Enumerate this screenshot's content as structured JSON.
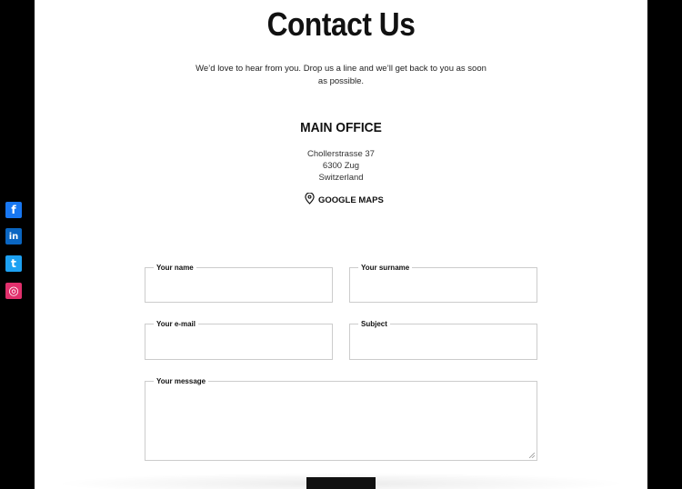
{
  "page": {
    "title": "Contact Us",
    "intro": "We’d love to hear from you. Drop us a line and we’ll get back to you as soon as possible."
  },
  "office": {
    "title": "MAIN OFFICE",
    "address_line1": "Chollerstrasse 37",
    "address_line2": "6300 Zug",
    "address_line3": "Switzerland",
    "maps_label": "GOOGLE MAPS"
  },
  "form": {
    "name_label": "Your name",
    "surname_label": "Your surname",
    "email_label": "Your e-mail",
    "subject_label": "Subject",
    "message_label": "Your message",
    "name_value": "",
    "surname_value": "",
    "email_value": "",
    "subject_value": "",
    "message_value": ""
  },
  "social": [
    {
      "name": "facebook-icon",
      "glyph": "f",
      "color": "#1877f2"
    },
    {
      "name": "linkedin-icon",
      "glyph": "in",
      "color": "#0a66c2"
    },
    {
      "name": "twitter-icon",
      "glyph": "t",
      "color": "#1da1f2"
    },
    {
      "name": "instagram-icon",
      "glyph": "◎",
      "color": "#e1306c"
    }
  ]
}
